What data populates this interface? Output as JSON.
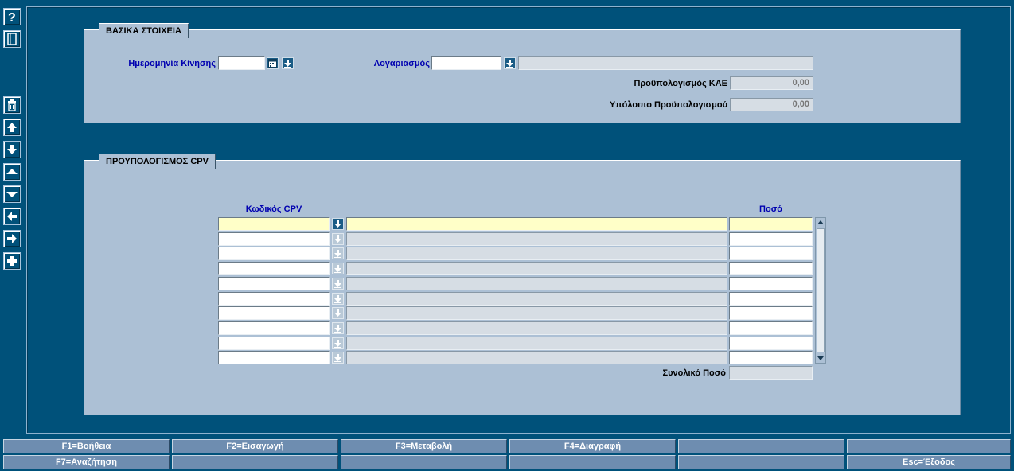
{
  "toolbar": {
    "icons": [
      "help-icon",
      "document-icon",
      "trash-icon",
      "first-record-icon",
      "last-record-icon",
      "previous-record-icon",
      "next-record-icon",
      "previous-page-icon",
      "next-page-icon",
      "add-icon"
    ]
  },
  "basic_panel": {
    "title": "ΒΑΣΙΚΑ ΣΤΟΙΧΕΙΑ",
    "date_label": "Ημερομηνία Κίνησης",
    "date_value": "",
    "account_label": "Λογαριασμός",
    "account_value": "",
    "account_desc": "",
    "budget_kae_label": "Προϋπολογισμός ΚΑΕ",
    "budget_kae_value": "0,00",
    "remaining_label": "Υπόλοιπο Προϋπολογισμού",
    "remaining_value": "0,00"
  },
  "cpv_panel": {
    "title": "ΠΡΟΥΠΟΛΟΓΙΣΜΟΣ CPV",
    "col_code": "Κωδικός CPV",
    "col_amount": "Ποσό",
    "rows": [
      {
        "code": "",
        "desc": "",
        "amount": ""
      },
      {
        "code": "",
        "desc": "",
        "amount": ""
      },
      {
        "code": "",
        "desc": "",
        "amount": ""
      },
      {
        "code": "",
        "desc": "",
        "amount": ""
      },
      {
        "code": "",
        "desc": "",
        "amount": ""
      },
      {
        "code": "",
        "desc": "",
        "amount": ""
      },
      {
        "code": "",
        "desc": "",
        "amount": ""
      },
      {
        "code": "",
        "desc": "",
        "amount": ""
      },
      {
        "code": "",
        "desc": "",
        "amount": ""
      },
      {
        "code": "",
        "desc": "",
        "amount": ""
      }
    ],
    "total_label": "Συνολικό Ποσό",
    "total_value": ""
  },
  "function_keys": {
    "row1": [
      "F1=Βοήθεια",
      "F2=Εισαγωγή",
      "F3=Μεταβολή",
      "F4=Διαγραφή",
      "",
      ""
    ],
    "row2": [
      "F7=Αναζήτηση",
      "",
      "",
      "",
      "",
      "Esc=Έξοδος"
    ]
  },
  "colors": {
    "background": "#00517a",
    "panel": "#acc0d5",
    "label_blue": "#0000b0",
    "current_row": "#ffffc8",
    "fkey": "#6e8db0"
  }
}
